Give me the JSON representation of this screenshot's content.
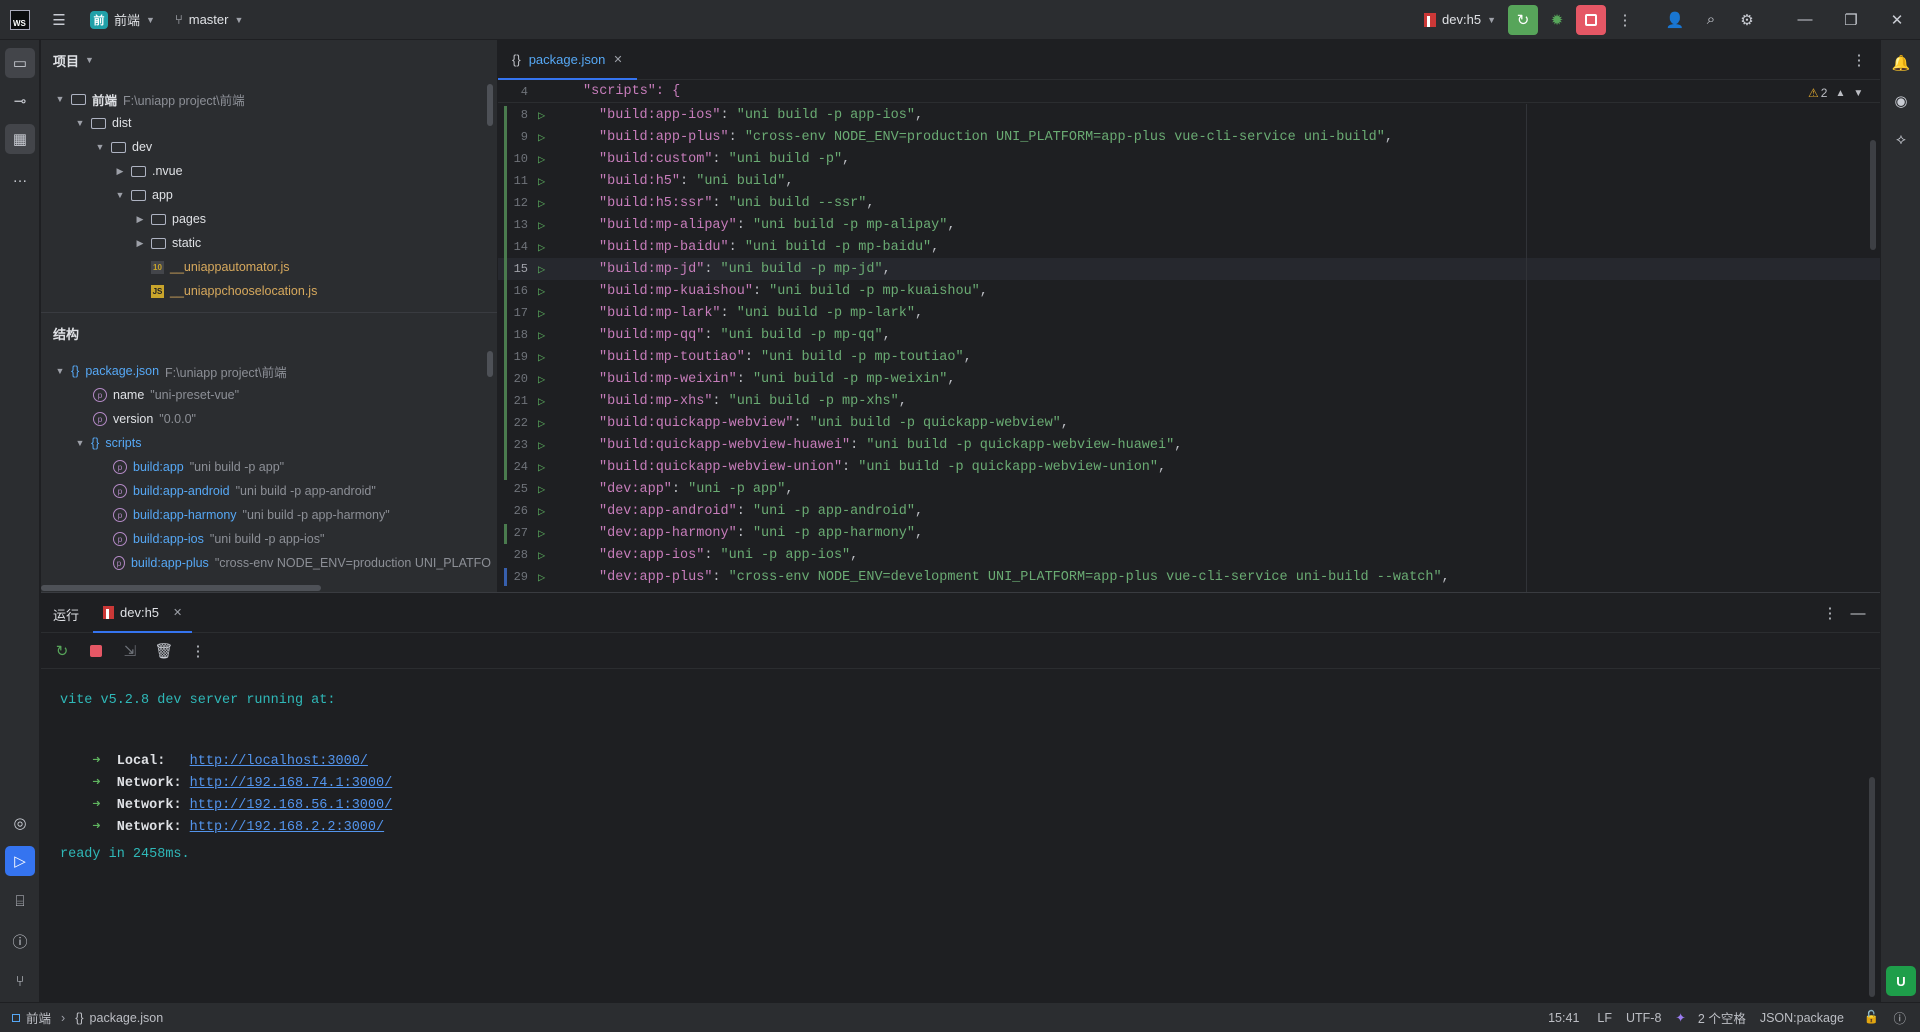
{
  "titlebar": {
    "app_logo": "WS",
    "project_name": "前端",
    "project_badge": "前",
    "branch": "master",
    "run_config": "dev:h5"
  },
  "project_panel": {
    "title": "项目",
    "tree": [
      {
        "label": "前端",
        "extra": "F:\\uniapp project\\前端"
      },
      {
        "label": "dist"
      },
      {
        "label": "dev"
      },
      {
        "label": ".nvue"
      },
      {
        "label": "app"
      },
      {
        "label": "pages"
      },
      {
        "label": "static"
      },
      {
        "label": "__uniappautomator.js"
      },
      {
        "label": "__uniappchooselocation.js"
      }
    ]
  },
  "structure_panel": {
    "title": "结构",
    "root_label": "package.json",
    "root_path": "F:\\uniapp project\\前端",
    "props": [
      {
        "name": "name",
        "value": "\"uni-preset-vue\""
      },
      {
        "name": "version",
        "value": "\"0.0.0\""
      }
    ],
    "scripts_label": "scripts",
    "scripts": [
      {
        "name": "build:app",
        "value": "\"uni build -p app\""
      },
      {
        "name": "build:app-android",
        "value": "\"uni build -p app-android\""
      },
      {
        "name": "build:app-harmony",
        "value": "\"uni build -p app-harmony\""
      },
      {
        "name": "build:app-ios",
        "value": "\"uni build -p app-ios\""
      },
      {
        "name": "build:app-plus",
        "value": "\"cross-env NODE_ENV=production UNI_PLATFO"
      }
    ]
  },
  "editor": {
    "tab_label": "package.json",
    "sticky_line": {
      "num": "4",
      "text": "\"scripts\": {"
    },
    "warnings": "2",
    "lines": [
      {
        "num": "8",
        "key": "\"build:app-ios\"",
        "val": "\"uni build -p app-ios\""
      },
      {
        "num": "9",
        "key": "\"build:app-plus\"",
        "val": "\"cross-env NODE_ENV=production UNI_PLATFORM=app-plus vue-cli-service uni-build\""
      },
      {
        "num": "10",
        "key": "\"build:custom\"",
        "val": "\"uni build -p\""
      },
      {
        "num": "11",
        "key": "\"build:h5\"",
        "val": "\"uni build\""
      },
      {
        "num": "12",
        "key": "\"build:h5:ssr\"",
        "val": "\"uni build --ssr\""
      },
      {
        "num": "13",
        "key": "\"build:mp-alipay\"",
        "val": "\"uni build -p mp-alipay\""
      },
      {
        "num": "14",
        "key": "\"build:mp-baidu\"",
        "val": "\"uni build -p mp-baidu\""
      },
      {
        "num": "15",
        "key": "\"build:mp-jd\"",
        "val": "\"uni build -p mp-jd\""
      },
      {
        "num": "16",
        "key": "\"build:mp-kuaishou\"",
        "val": "\"uni build -p mp-kuaishou\""
      },
      {
        "num": "17",
        "key": "\"build:mp-lark\"",
        "val": "\"uni build -p mp-lark\""
      },
      {
        "num": "18",
        "key": "\"build:mp-qq\"",
        "val": "\"uni build -p mp-qq\""
      },
      {
        "num": "19",
        "key": "\"build:mp-toutiao\"",
        "val": "\"uni build -p mp-toutiao\""
      },
      {
        "num": "20",
        "key": "\"build:mp-weixin\"",
        "val": "\"uni build -p mp-weixin\""
      },
      {
        "num": "21",
        "key": "\"build:mp-xhs\"",
        "val": "\"uni build -p mp-xhs\""
      },
      {
        "num": "22",
        "key": "\"build:quickapp-webview\"",
        "val": "\"uni build -p quickapp-webview\""
      },
      {
        "num": "23",
        "key": "\"build:quickapp-webview-huawei\"",
        "val": "\"uni build -p quickapp-webview-huawei\""
      },
      {
        "num": "24",
        "key": "\"build:quickapp-webview-union\"",
        "val": "\"uni build -p quickapp-webview-union\""
      },
      {
        "num": "25",
        "key": "\"dev:app\"",
        "val": "\"uni -p app\""
      },
      {
        "num": "26",
        "key": "\"dev:app-android\"",
        "val": "\"uni -p app-android\""
      },
      {
        "num": "27",
        "key": "\"dev:app-harmony\"",
        "val": "\"uni -p app-harmony\""
      },
      {
        "num": "28",
        "key": "\"dev:app-ios\"",
        "val": "\"uni -p app-ios\""
      },
      {
        "num": "29",
        "key": "\"dev:app-plus\"",
        "val": "\"cross-env NODE_ENV=development UNI_PLATFORM=app-plus vue-cli-service uni-build --watch\""
      }
    ]
  },
  "run_panel": {
    "title": "运行",
    "tab_label": "dev:h5",
    "output": {
      "header": "vite v5.2.8 dev server running at:",
      "entries": [
        {
          "arrow": "➜",
          "label": "Local:",
          "url": "http://localhost:3000/"
        },
        {
          "arrow": "➜",
          "label": "Network:",
          "url": "http://192.168.74.1:3000/"
        },
        {
          "arrow": "➜",
          "label": "Network:",
          "url": "http://192.168.56.1:3000/"
        },
        {
          "arrow": "➜",
          "label": "Network:",
          "url": "http://192.168.2.2:3000/"
        }
      ],
      "ready": "ready in 2458ms."
    }
  },
  "statusbar": {
    "breadcrumb_project": "前端",
    "breadcrumb_file": "package.json",
    "position": "15:41",
    "line_sep": "LF",
    "encoding": "UTF-8",
    "indent": "2 个空格",
    "schema": "JSON:package"
  },
  "colors": {
    "accent": "#3574f0",
    "run_green": "#57a55a",
    "stop_red": "#e55765"
  }
}
